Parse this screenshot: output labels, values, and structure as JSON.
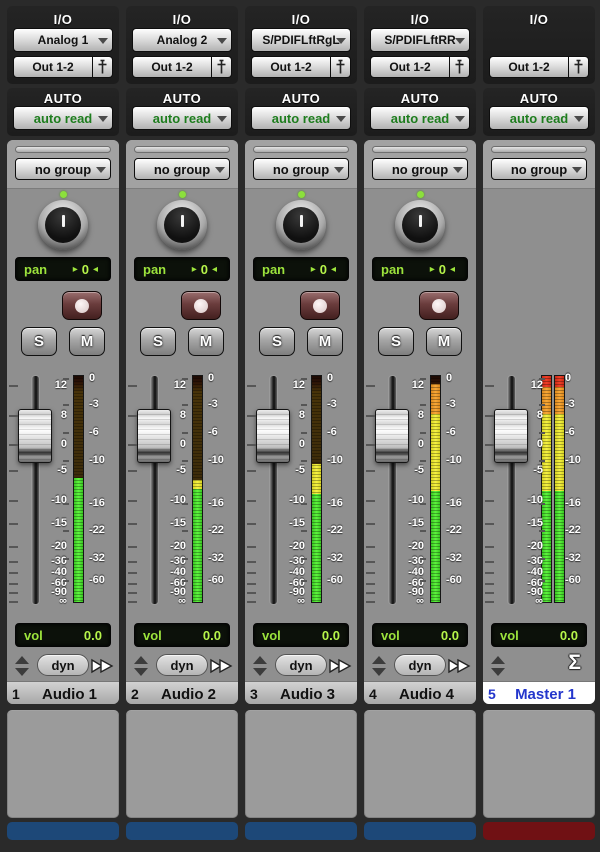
{
  "fader_scale": [
    "12",
    "8",
    "0",
    "-5",
    "-10",
    "-15",
    "-20",
    "-30",
    "-40",
    "-60",
    "-90",
    "∞"
  ],
  "meter_scale": [
    "0",
    "-3",
    "-6",
    "-10",
    "-16",
    "-22",
    "-32",
    "-60"
  ],
  "icons": {
    "dropdown": "chevron-down",
    "output_window": "mini-fader",
    "record": "record-dot",
    "insert_arrows": "double-arrow",
    "sum": "Σ",
    "pan_left_arrow": "◂",
    "pan_right_arrow": "▸"
  },
  "colors": {
    "lcd_green": "#9ce33c",
    "meter_green": "#4ee22e",
    "meter_yellow": "#f2ee38",
    "meter_orange": "#f49a28",
    "meter_red": "#e8301c",
    "auto_text_green": "#1e7d1e",
    "track_bar_blue": "#1d4878",
    "master_bar_red": "#701114",
    "master_name_text": "#2336cc",
    "master_name_bg": "#ffffff"
  },
  "strips": [
    {
      "io_label": "I/O",
      "input": "Analog 1",
      "output": "Out 1-2",
      "auto_label": "AUTO",
      "auto_mode": "auto read",
      "group": "no group",
      "pan_label": "pan",
      "pan_value": "0",
      "solo": "S",
      "mute": "M",
      "vol_label": "vol",
      "vol_value": "0.0",
      "insert": "dyn",
      "number": "1",
      "name": "Audio 1",
      "bar": "blue",
      "meters": [
        [
          {
            "c": "dim",
            "pct": 45
          },
          {
            "c": "green",
            "pct": 55
          }
        ]
      ]
    },
    {
      "io_label": "I/O",
      "input": "Analog 2",
      "output": "Out 1-2",
      "auto_label": "AUTO",
      "auto_mode": "auto read",
      "group": "no group",
      "pan_label": "pan",
      "pan_value": "0",
      "solo": "S",
      "mute": "M",
      "vol_label": "vol",
      "vol_value": "0.0",
      "insert": "dyn",
      "number": "2",
      "name": "Audio 2",
      "bar": "blue",
      "meters": [
        [
          {
            "c": "dim",
            "pct": 46
          },
          {
            "c": "yellow",
            "pct": 4
          },
          {
            "c": "green",
            "pct": 50
          }
        ]
      ]
    },
    {
      "io_label": "I/O",
      "input": "S/PDIFLftRgL",
      "output": "Out 1-2",
      "auto_label": "AUTO",
      "auto_mode": "auto read",
      "group": "no group",
      "pan_label": "pan",
      "pan_value": "0",
      "solo": "S",
      "mute": "M",
      "vol_label": "vol",
      "vol_value": "0.0",
      "insert": "dyn",
      "number": "3",
      "name": "Audio 3",
      "bar": "blue",
      "meters": [
        [
          {
            "c": "dim",
            "pct": 39
          },
          {
            "c": "yellow",
            "pct": 13
          },
          {
            "c": "green",
            "pct": 48
          }
        ]
      ]
    },
    {
      "io_label": "I/O",
      "input": "S/PDIFLftRR",
      "output": "Out 1-2",
      "auto_label": "AUTO",
      "auto_mode": "auto read",
      "group": "no group",
      "pan_label": "pan",
      "pan_value": "0",
      "solo": "S",
      "mute": "M",
      "vol_label": "vol",
      "vol_value": "0.0",
      "insert": "dyn",
      "number": "4",
      "name": "Audio 4",
      "bar": "blue",
      "meters": [
        [
          {
            "c": "dim",
            "pct": 3.5
          },
          {
            "c": "orange",
            "pct": 13.5
          },
          {
            "c": "yellow",
            "pct": 34
          },
          {
            "c": "green",
            "pct": 49
          }
        ]
      ]
    },
    {
      "io_label": "I/O",
      "input": null,
      "output": "Out 1-2",
      "auto_label": "AUTO",
      "auto_mode": "auto read",
      "group": "no group",
      "vol_label": "vol",
      "vol_value": "0.0",
      "sigma": "Σ",
      "number": "5",
      "name": "Master 1",
      "bar": "red",
      "meters": [
        [
          {
            "c": "red",
            "pct": 5
          },
          {
            "c": "orange",
            "pct": 12
          },
          {
            "c": "yellow",
            "pct": 34
          },
          {
            "c": "green",
            "pct": 49
          }
        ],
        [
          {
            "c": "red",
            "pct": 5
          },
          {
            "c": "orange",
            "pct": 12
          },
          {
            "c": "yellow",
            "pct": 34
          },
          {
            "c": "green",
            "pct": 49
          }
        ]
      ]
    }
  ]
}
